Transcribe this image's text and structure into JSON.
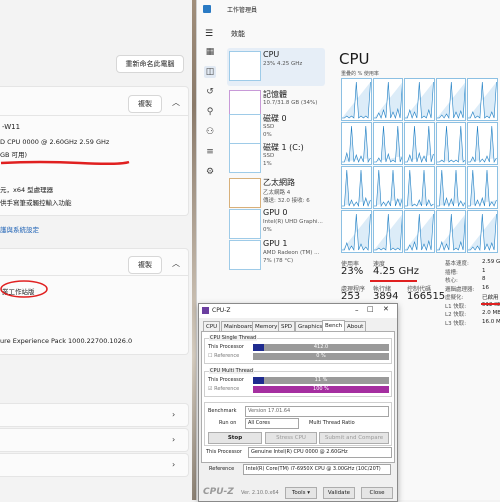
{
  "settings": {
    "rename_button": "重新命名此電腦",
    "copy_button_1": "複製",
    "device_name_partial": "-W11",
    "processor_partial": "D CPU 0000 @ 2.60GHz   2.59 GHz",
    "ram_partial": "GB 可用)",
    "system_type_partial": "元，x64 型處理器",
    "pen_touch_partial": "供手寫筆或觸控輸入功能",
    "link_partial": "護與系統設定",
    "copy_button_2": "複製",
    "edition_partial": "業工作站版",
    "experience_partial": "ure Experience Pack 1000.22700.1026.0"
  },
  "taskmgr": {
    "title": "工作管理員",
    "section_title": "效能",
    "resources": [
      {
        "name": "CPU",
        "sub1": "23% 4.25 GHz",
        "sub2": ""
      },
      {
        "name": "記憶體",
        "sub1": "10.7/31.8 GB (34%)",
        "sub2": ""
      },
      {
        "name": "磁碟 0",
        "sub1": "SSD",
        "sub2": "0%"
      },
      {
        "name": "磁碟 1 (C:)",
        "sub1": "SSD",
        "sub2": "1%"
      },
      {
        "name": "乙太網路",
        "sub1": "乙太網路 4",
        "sub2": "傳送: 32.0 接收: 6"
      },
      {
        "name": "GPU 0",
        "sub1": "Intel(R) UHD Graphi...",
        "sub2": "0%"
      },
      {
        "name": "GPU 1",
        "sub1": "AMD Radeon (TM) ...",
        "sub2": "7% (78 °C)"
      }
    ],
    "main_title": "CPU",
    "graph_label": "重疊的 % 使用率",
    "stats": {
      "util_label": "使用率",
      "util_value": "23%",
      "speed_label": "速度",
      "speed_value": "4.25 GHz",
      "proc_label": "處理程序",
      "proc_value": "253",
      "threads_label": "執行緒",
      "threads_value": "3894",
      "handles_label": "控制代碼",
      "handles_value": "166515"
    },
    "details": [
      {
        "k": "基本速度:",
        "v": "2.59 GH"
      },
      {
        "k": "插槽:",
        "v": "1"
      },
      {
        "k": "核心:",
        "v": "8"
      },
      {
        "k": "邏輯處理器:",
        "v": "16"
      },
      {
        "k": "虛擬化:",
        "v": "已啟用"
      },
      {
        "k": "L1 快取:",
        "v": "512 KB"
      },
      {
        "k": "L2 快取:",
        "v": "2.0 MB"
      },
      {
        "k": "L3 快取:",
        "v": "16.0 M"
      }
    ]
  },
  "cpuz": {
    "title": "CPU-Z",
    "tabs": [
      "CPU",
      "Mainboard",
      "Memory",
      "SPD",
      "Graphics",
      "Bench",
      "About"
    ],
    "single_group": "CPU Single Thread",
    "multi_group": "CPU Multi Thread",
    "this_processor": "This Processor",
    "reference": "Reference",
    "single_this_value": "412.0",
    "single_this_fraction": 0.08,
    "single_ref_value": "0 %",
    "multi_this_value": "11 %",
    "multi_this_fraction": 0.08,
    "multi_ref_value": "100 %",
    "multi_ref_fraction": 1.0,
    "benchmark_label": "Benchmark",
    "benchmark_value": "Version 17.01.64",
    "runon_label": "Run on",
    "runon_value": "All Cores",
    "ratio_label": "Multi Thread Ratio",
    "stop_button": "Stop",
    "stress_button": "Stress CPU",
    "submit_button": "Submit and Compare",
    "this_proc_label": "This Processor",
    "this_proc_value": "Genuine Intel(R) CPU 0000 @ 2.60GHz",
    "reference_label": "Reference",
    "reference_value": "Intel(R) Core(TM) i7-6950X CPU @ 3.00GHz (10C/20T)",
    "brand": "CPU-Z",
    "version": "Ver. 2.10.0.x64",
    "tools_button": "Tools",
    "validate_button": "Validate",
    "close_button": "Close"
  }
}
